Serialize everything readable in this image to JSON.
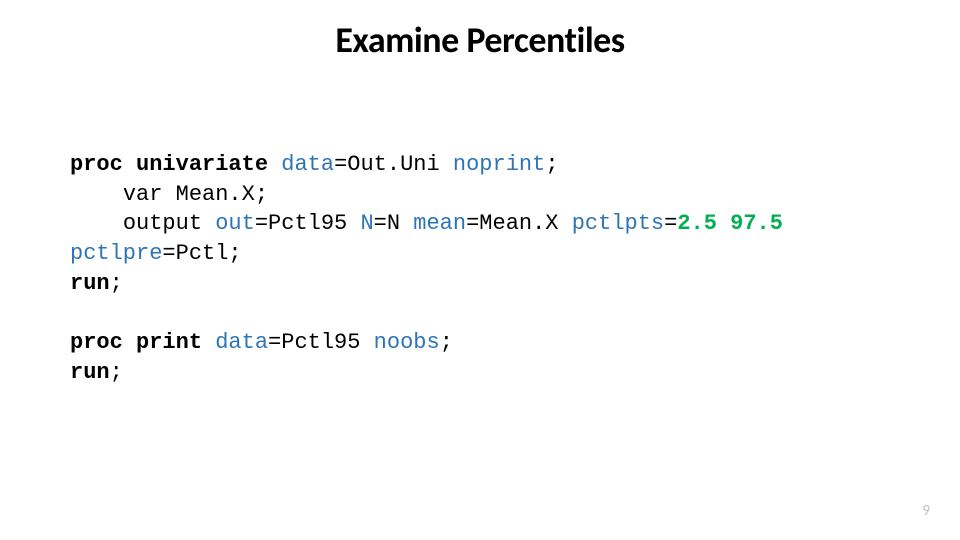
{
  "title": "Examine Percentiles",
  "code": {
    "proc": "proc",
    "univariate": "univariate",
    "data_kw1": "data",
    "eq": "=",
    "outuni": "Out.Uni",
    "noprint": "noprint",
    "semi": ";",
    "var": "var",
    "meanx": "Mean.X;",
    "output": "output",
    "out_kw": "out",
    "pctl95": "Pctl95",
    "n_kw": "N",
    "nval": "N",
    "mean_kw": "mean",
    "meanxval": "Mean.X",
    "pctlpts_kw": "pctlpts",
    "pval1": "2.5",
    "pval2": "97.5",
    "pctlpre_kw": "pctlpre",
    "pctl": "Pctl;",
    "run": "run",
    "print": "print",
    "data_kw2": "data",
    "pctl95b": "Pctl95",
    "noobs": "noobs"
  },
  "pagenum": "9"
}
